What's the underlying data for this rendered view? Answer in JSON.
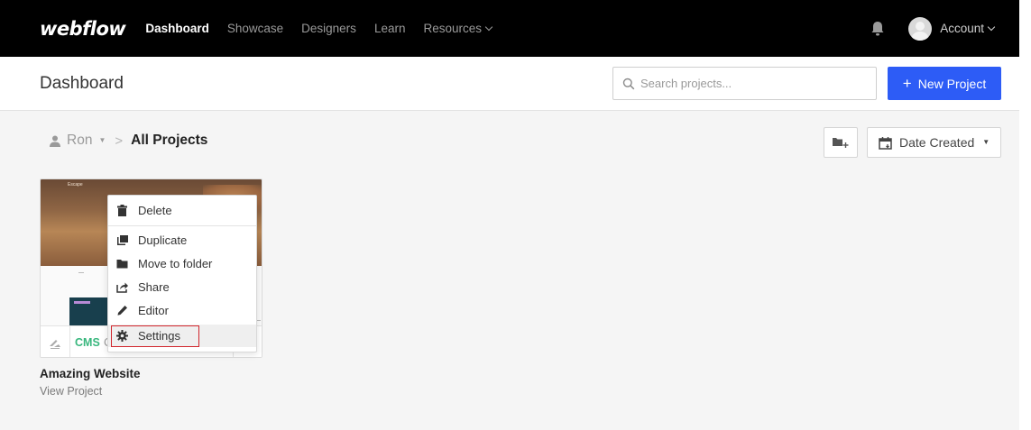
{
  "topnav": {
    "logo": "webflow",
    "links": [
      "Dashboard",
      "Showcase",
      "Designers",
      "Learn",
      "Resources"
    ],
    "active": "Dashboard",
    "account_label": "Account"
  },
  "header": {
    "title": "Dashboard",
    "search_placeholder": "Search projects...",
    "new_project_label": "New Project",
    "new_project_plus": "+"
  },
  "toolbar": {
    "breadcrumb_user": "Ron",
    "breadcrumb_separator": ">",
    "breadcrumb_current": "All Projects",
    "sort_label": "Date Created"
  },
  "project": {
    "thumb_brand": "Escape",
    "badge": "CMS",
    "badge_partial": "C",
    "title": "Amazing Website",
    "link": "View Project"
  },
  "context_menu": {
    "items": [
      "Delete",
      "Duplicate",
      "Move to folder",
      "Share",
      "Editor",
      "Settings"
    ]
  },
  "colors": {
    "nav_bg": "#000000",
    "primary": "#2d5cf6",
    "cms_green": "#39b77e",
    "highlight_red": "#d1272d",
    "content_bg": "#f5f5f5"
  }
}
